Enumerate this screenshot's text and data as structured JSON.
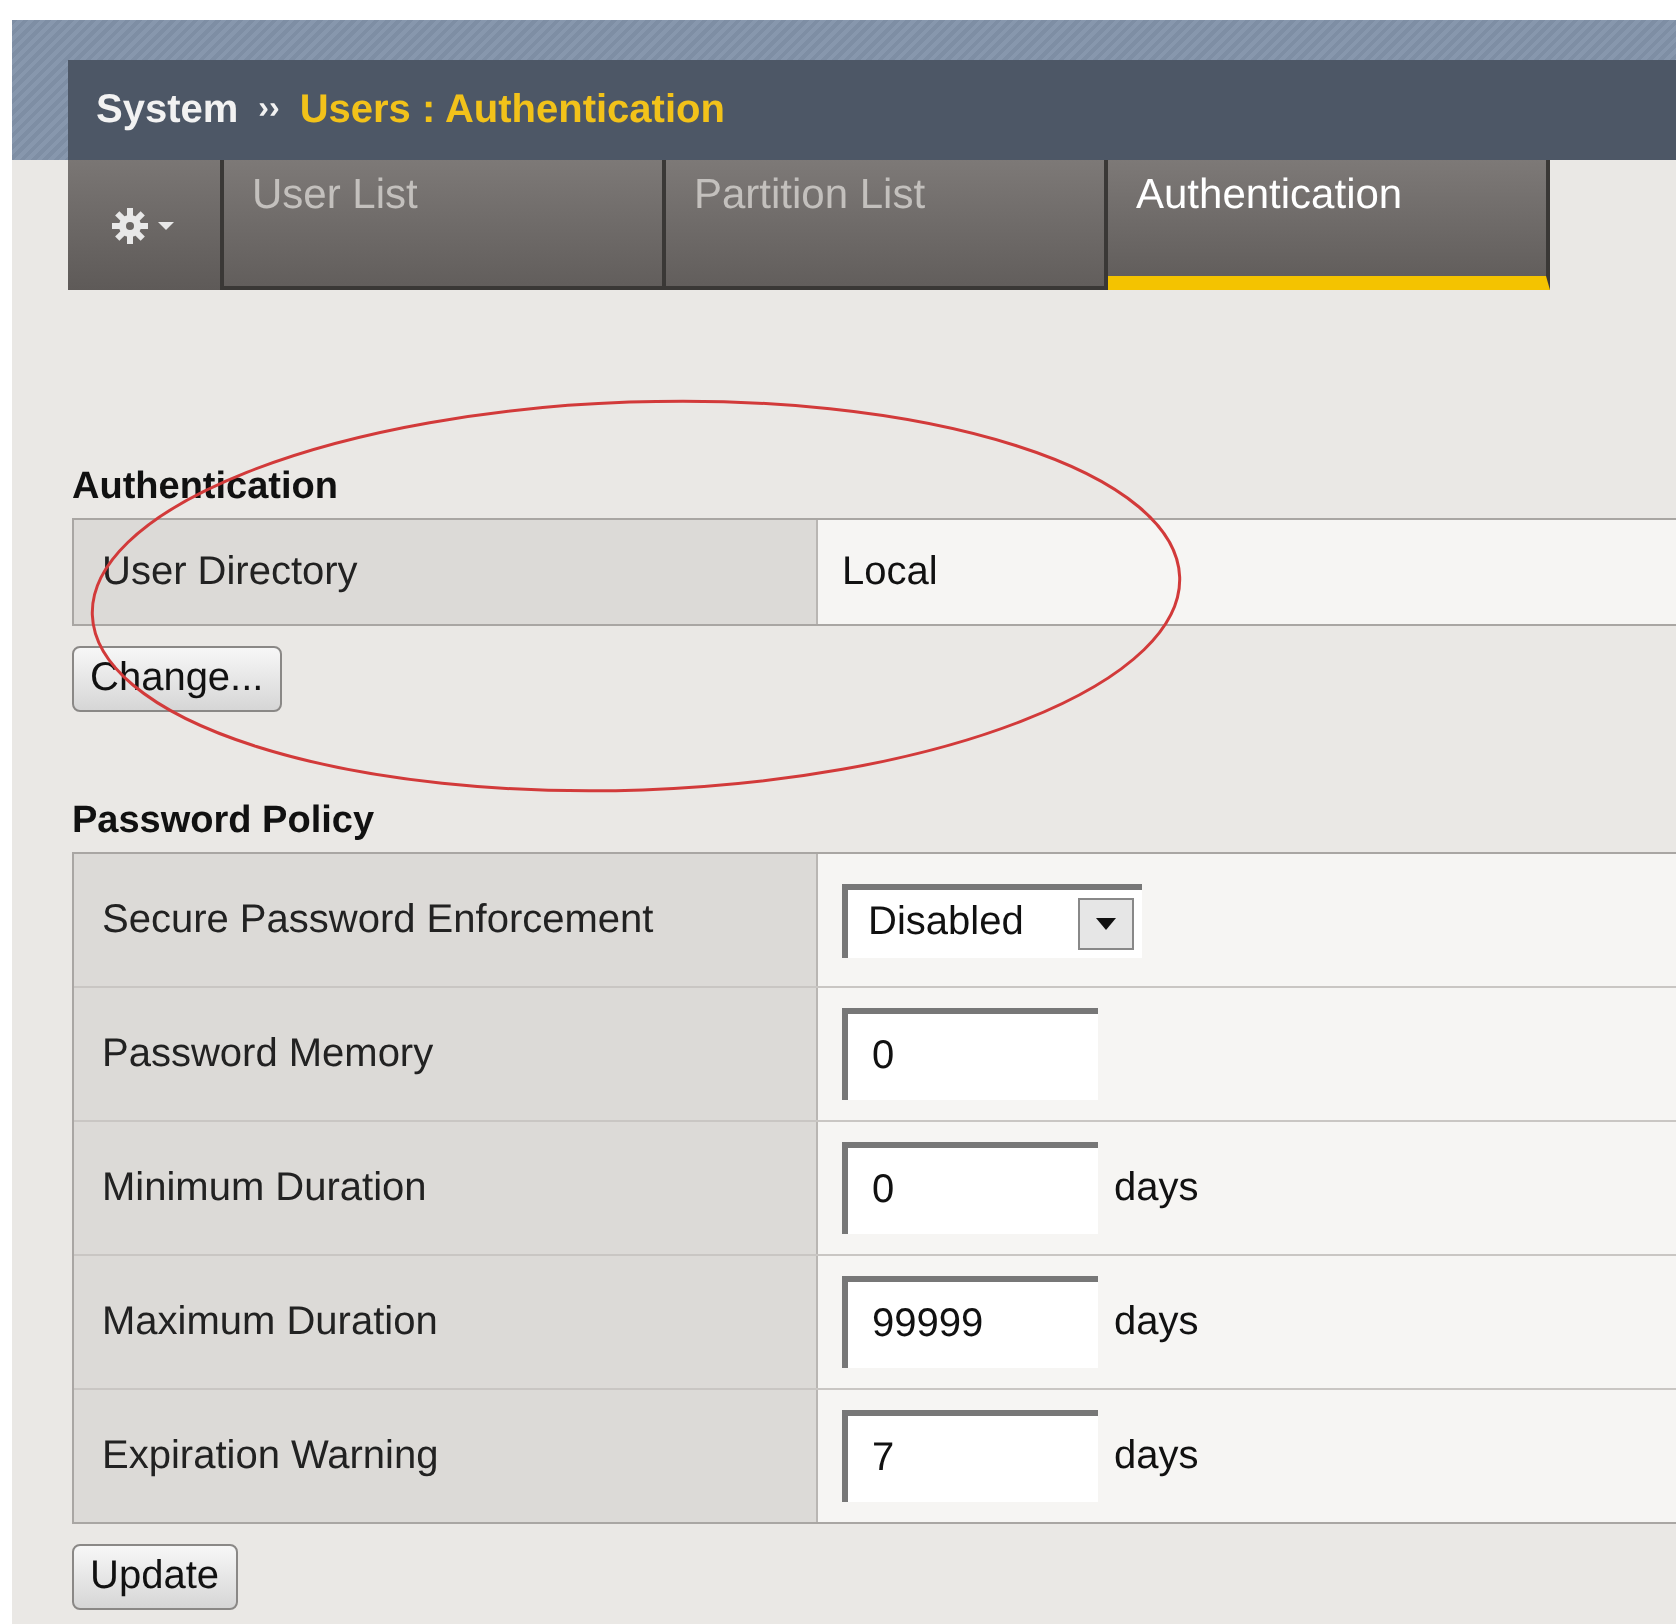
{
  "breadcrumb": {
    "root": "System",
    "separator": "››",
    "current": "Users : Authentication"
  },
  "tabs": [
    {
      "label": "User List",
      "selected": false
    },
    {
      "label": "Partition List",
      "selected": false
    },
    {
      "label": "Authentication",
      "selected": true
    }
  ],
  "authentication": {
    "heading": "Authentication",
    "label": "User Directory",
    "value": "Local",
    "button": "Change..."
  },
  "password_policy": {
    "heading": "Password Policy",
    "rows": [
      {
        "kind": "select",
        "label": "Secure Password Enforcement",
        "value": "Disabled"
      },
      {
        "kind": "text",
        "label": "Password Memory",
        "value": "0"
      },
      {
        "kind": "text",
        "label": "Minimum Duration",
        "value": "0",
        "unit": "days"
      },
      {
        "kind": "text",
        "label": "Maximum Duration",
        "value": "99999",
        "unit": "days"
      },
      {
        "kind": "text",
        "label": "Expiration Warning",
        "value": "7",
        "unit": "days"
      }
    ],
    "button": "Update"
  }
}
